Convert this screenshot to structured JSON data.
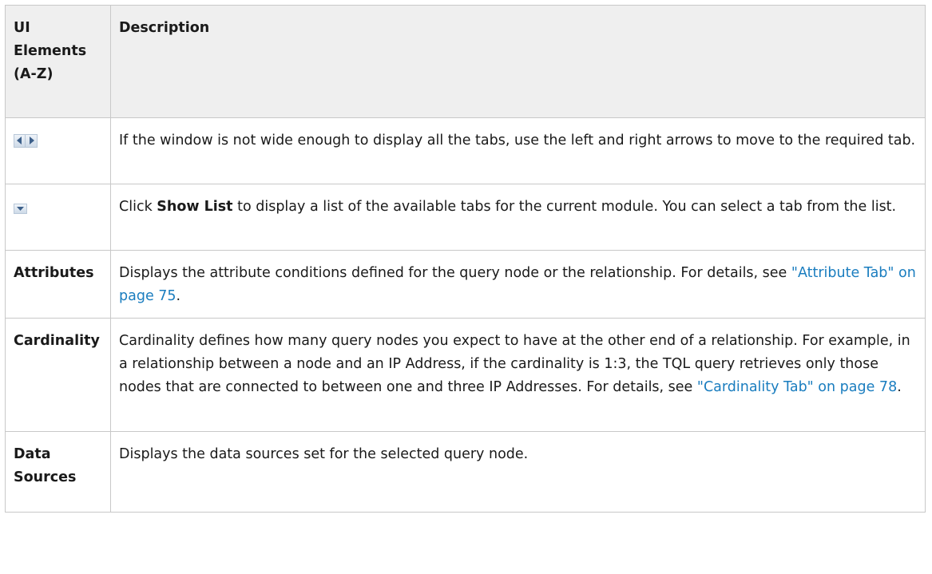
{
  "table": {
    "headers": {
      "col1_line1": "UI",
      "col1_line2": "Elements",
      "col1_line3": "(A-Z)",
      "col2": "Description"
    },
    "rows": [
      {
        "icon": "left-right-arrows-icon",
        "desc_text": "If the window is not wide enough to display all the tabs, use the left and right arrows to move to the required tab."
      },
      {
        "icon": "dropdown-arrow-icon",
        "desc_pre": "Click ",
        "desc_bold": "Show List",
        "desc_post": " to display a list of the available tabs for the current module. You can select a tab from the list."
      },
      {
        "term": "Attributes",
        "desc_pre": "Displays the attribute conditions defined for the query node or the relationship. For details, see ",
        "desc_link": "\"Attribute Tab\" on page 75",
        "desc_post": "."
      },
      {
        "term": "Cardinality",
        "desc_pre": "Cardinality defines how many query nodes you expect to have at the other end of a relationship. For example, in a relationship between a node and an IP Address, if the cardinality is 1:3, the TQL query retrieves only those nodes that are connected to between one and three IP Addresses. For details, see ",
        "desc_link": "\"Cardinality Tab\" on page 78",
        "desc_post": "."
      },
      {
        "term_line1": "Data",
        "term_line2": "Sources",
        "desc_text": "Displays the data sources set for the selected query node."
      }
    ]
  },
  "colors": {
    "header_bg": "#efefef",
    "border": "#c8c8c8",
    "link": "#1a7dbf"
  }
}
